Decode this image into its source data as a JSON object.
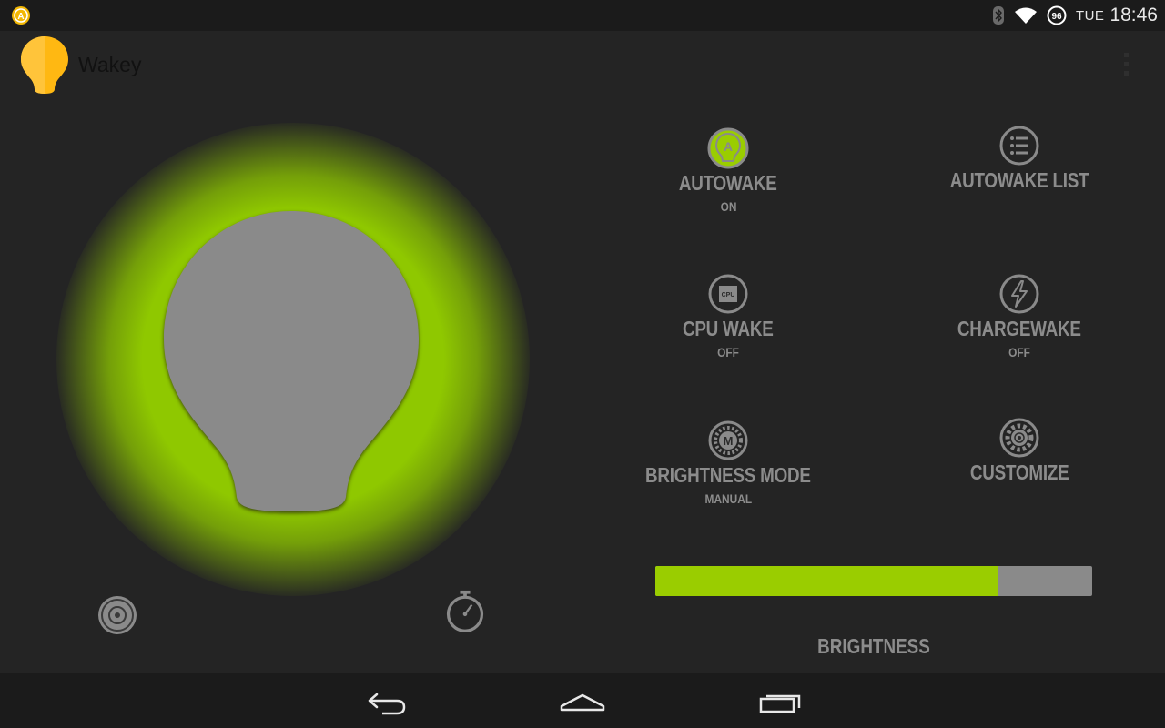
{
  "status_bar": {
    "day": "TUE",
    "time": "18:46",
    "battery": "96",
    "icons": [
      "autowake-notification-icon",
      "bluetooth-icon",
      "wifi-icon",
      "battery-icon"
    ]
  },
  "action_bar": {
    "title": "Wakey",
    "app_icon": "lightbulb-icon",
    "overflow_icon": "overflow-menu-icon"
  },
  "bulb": {
    "state": "on",
    "glow_color": "#8fc800",
    "bulb_color": "#8a8a8a"
  },
  "bottom_controls": [
    {
      "icon": "disc-icon"
    },
    {
      "icon": "timer-icon"
    }
  ],
  "tiles": [
    {
      "label": "AUTOWAKE",
      "sub": "ON",
      "icon": "autowake-icon",
      "active": true
    },
    {
      "label": "AUTOWAKE LIST",
      "sub": "",
      "icon": "list-icon",
      "active": false
    },
    {
      "label": "CPU WAKE",
      "sub": "OFF",
      "icon": "cpu-icon",
      "active": false
    },
    {
      "label": "CHARGEWAKE",
      "sub": "OFF",
      "icon": "lightning-icon",
      "active": false
    },
    {
      "label": "BRIGHTNESS MODE",
      "sub": "MANUAL",
      "icon": "manual-mode-icon",
      "active": false
    },
    {
      "label": "CUSTOMIZE",
      "sub": "",
      "icon": "gear-icon",
      "active": false
    }
  ],
  "brightness": {
    "label": "BRIGHTNESS",
    "value_fraction": 0.785,
    "fill_color": "#9acd00",
    "track_color": "#8a8a8a"
  },
  "nav_bar": {
    "buttons": [
      "back-icon",
      "home-icon",
      "recents-icon"
    ]
  },
  "accent_color": "#9acd00"
}
